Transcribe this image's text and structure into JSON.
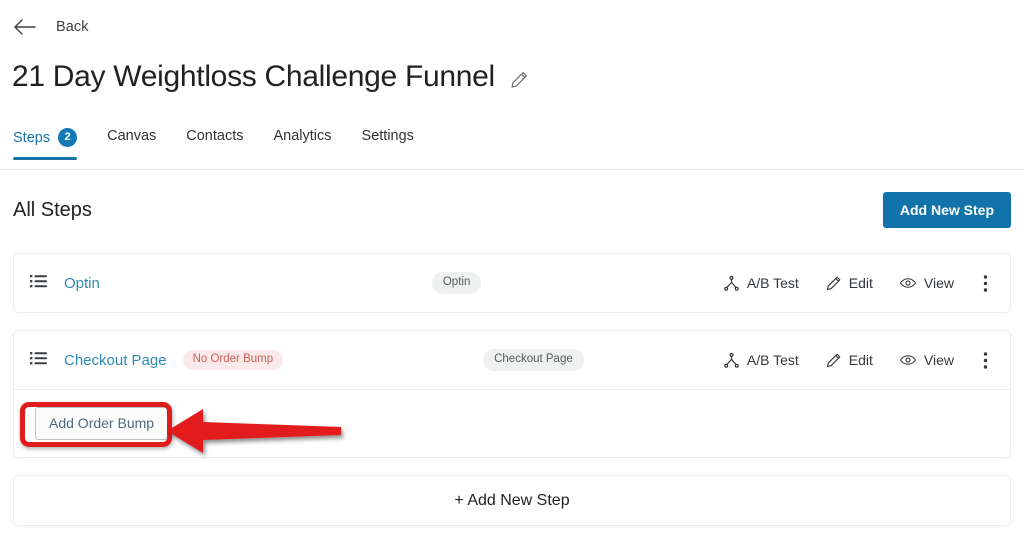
{
  "nav": {
    "back_label": "Back",
    "back_icon": "arrow-left-icon"
  },
  "header": {
    "title": "21 Day Weightloss Challenge Funnel",
    "edit_icon": "pencil-icon"
  },
  "tabs": [
    {
      "label": "Steps",
      "badge": "2",
      "active": true
    },
    {
      "label": "Canvas",
      "badge": "",
      "active": false
    },
    {
      "label": "Contacts",
      "badge": "",
      "active": false
    },
    {
      "label": "Analytics",
      "badge": "",
      "active": false
    },
    {
      "label": "Settings",
      "badge": "",
      "active": false
    }
  ],
  "section": {
    "heading": "All Steps",
    "add_new_step_button": "Add New Step"
  },
  "steps": [
    {
      "handle_icon": "list-handle-icon",
      "name": "Optin",
      "warning_badge": "",
      "type_badge": "Optin",
      "actions": {
        "ab_test": "A/B Test",
        "edit": "Edit",
        "view": "View",
        "more": "more-options"
      }
    },
    {
      "handle_icon": "list-handle-icon",
      "name": "Checkout Page",
      "warning_badge": "No Order Bump",
      "type_badge": "Checkout Page",
      "actions": {
        "ab_test": "A/B Test",
        "edit": "Edit",
        "view": "View",
        "more": "more-options"
      },
      "sub_action": "Add Order Bump"
    }
  ],
  "footer": {
    "add_new_step": "+ Add New Step"
  },
  "annotation": {
    "highlight_target": "Add Order Bump",
    "color": "#e21b1b",
    "arrow_direction": "left"
  },
  "colors": {
    "accent_blue": "#1273ab",
    "tab_active": "#1a73a7",
    "link_blue": "#2c8ab8",
    "warning_bg": "#fbe9e9",
    "warning_text": "#c8605d",
    "pill_bg": "#eff0f0",
    "annotation_red": "#e21b1b"
  }
}
